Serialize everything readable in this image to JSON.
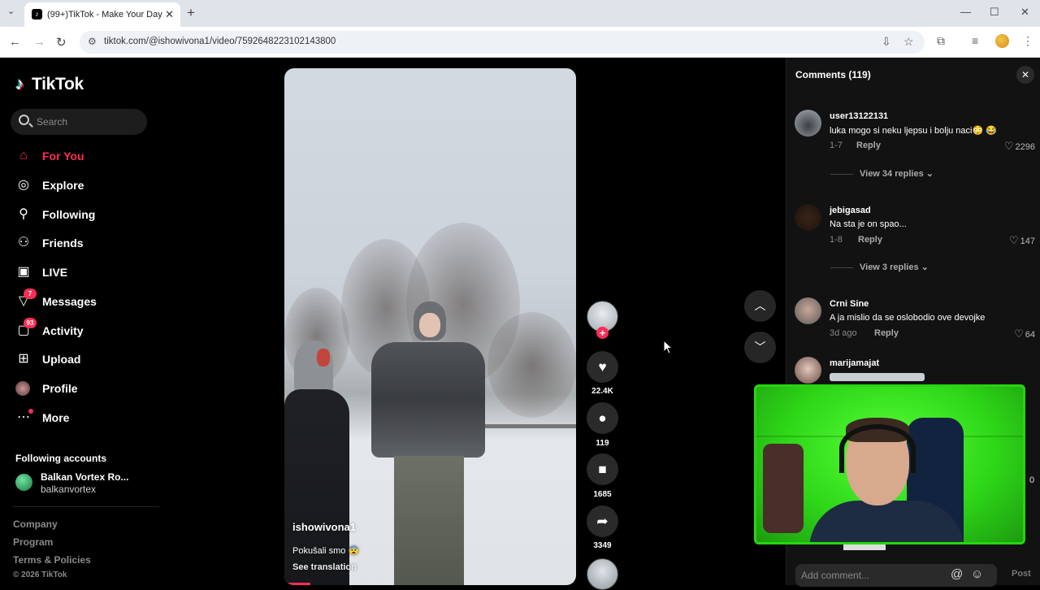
{
  "browser": {
    "tab_title": "(99+)TikTok - Make Your Day",
    "url": "tiktok.com/@ishowivona1/video/7592648223102143800"
  },
  "sidebar": {
    "logo": "TikTok",
    "search_placeholder": "Search",
    "nav": [
      {
        "label": "For You",
        "icon": "home-icon",
        "active": true
      },
      {
        "label": "Explore",
        "icon": "compass-icon"
      },
      {
        "label": "Following",
        "icon": "person-follow-icon"
      },
      {
        "label": "Friends",
        "icon": "friends-icon"
      },
      {
        "label": "LIVE",
        "icon": "live-icon"
      },
      {
        "label": "Messages",
        "icon": "messages-icon",
        "badge": "7"
      },
      {
        "label": "Activity",
        "icon": "activity-icon",
        "badge": "93"
      },
      {
        "label": "Upload",
        "icon": "upload-icon"
      },
      {
        "label": "Profile",
        "icon": "profile-avatar"
      },
      {
        "label": "More",
        "icon": "more-icon"
      }
    ],
    "following_heading": "Following accounts",
    "following_account": {
      "name": "Balkan Vortex Ro...",
      "handle": "balkanvortex"
    },
    "footer": {
      "company": "Company",
      "program": "Program",
      "terms": "Terms & Policies",
      "copyright": "© 2026 TikTok"
    }
  },
  "video": {
    "username": "ishowivona1",
    "caption": "Pokušali smo 😨",
    "see_translation": "See translation"
  },
  "actions": {
    "likes": "22.4K",
    "comments": "119",
    "saves": "1685",
    "shares": "3349"
  },
  "comments_panel": {
    "title": "Comments",
    "count": "(119)",
    "items": [
      {
        "user": "user13122131",
        "text": "luka mogo si neku ljepsu i bolju naci😳 😂",
        "date": "1-7",
        "reply": "Reply",
        "likes": "2296",
        "view_replies": "View 34 replies"
      },
      {
        "user": "jebigasad",
        "text": "Na sta je on spao...",
        "date": "1-8",
        "reply": "Reply",
        "likes": "147",
        "view_replies": "View 3 replies"
      },
      {
        "user": "Crni Sine",
        "text": "A ja mislio da se oslobodio ove devojke",
        "date": "3d ago",
        "reply": "Reply",
        "likes": "64"
      },
      {
        "user": "marijamajat"
      }
    ],
    "input_placeholder": "Add comment...",
    "post_label": "Post",
    "side_count": "0"
  }
}
